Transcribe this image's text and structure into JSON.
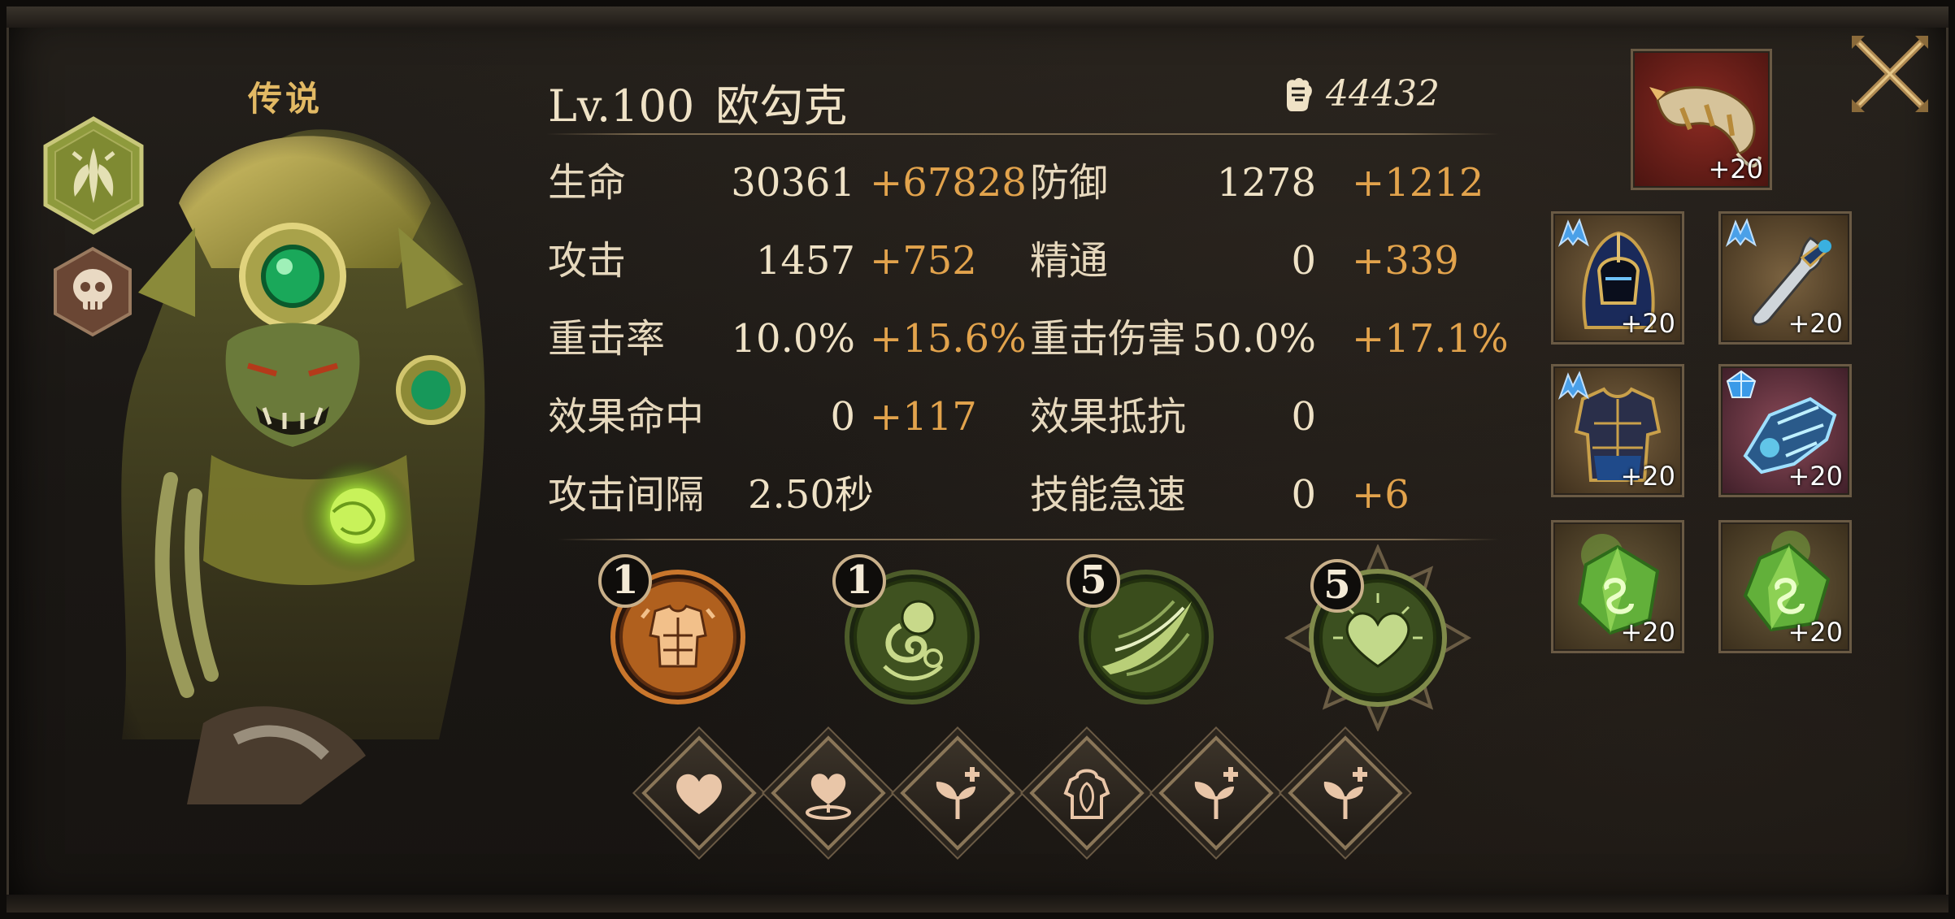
{
  "hero": {
    "rarity": "传说",
    "level": "Lv.100",
    "name": "欧勾克",
    "power": "44432"
  },
  "stats": [
    {
      "label": "生命",
      "base": "30361",
      "bonus": "+67828"
    },
    {
      "label": "防御",
      "base": "1278",
      "bonus": "+1212"
    },
    {
      "label": "攻击",
      "base": "1457",
      "bonus": "+752"
    },
    {
      "label": "精通",
      "base": "0",
      "bonus": "+339"
    },
    {
      "label": "重击率",
      "base": "10.0%",
      "bonus": "+15.6%"
    },
    {
      "label": "重击伤害",
      "base": "50.0%",
      "bonus": "+17.1%"
    },
    {
      "label": "效果命中",
      "base": "0",
      "bonus": "+117"
    },
    {
      "label": "效果抵抗",
      "base": "0",
      "bonus": ""
    },
    {
      "label": "攻击间隔",
      "base": "2.50秒",
      "bonus": ""
    },
    {
      "label": "技能急速",
      "base": "0",
      "bonus": "+6"
    }
  ],
  "skills": [
    {
      "level": "1",
      "icon": "armor-skill-icon"
    },
    {
      "level": "1",
      "icon": "vine-skill-icon"
    },
    {
      "level": "5",
      "icon": "leaf-strike-skill-icon"
    },
    {
      "level": "5",
      "icon": "heart-skill-icon"
    }
  ],
  "traits": [
    {
      "icon": "heart-icon"
    },
    {
      "icon": "heart-aura-icon"
    },
    {
      "icon": "sprout-plus-icon"
    },
    {
      "icon": "body-shield-icon"
    },
    {
      "icon": "sprout-plus-icon"
    },
    {
      "icon": "sprout-plus-icon"
    }
  ],
  "equipment": [
    {
      "slot": "horn-relic",
      "level": "+20"
    },
    {
      "slot": "helmet",
      "level": "+20"
    },
    {
      "slot": "dagger",
      "level": "+20"
    },
    {
      "slot": "armor",
      "level": "+20"
    },
    {
      "slot": "gauntlet",
      "level": "+20"
    },
    {
      "slot": "gem-left",
      "level": "+20"
    },
    {
      "slot": "gem-right",
      "level": "+20"
    }
  ],
  "colors": {
    "bonus": "#e2a34c",
    "rarity": "#e2b964",
    "text": "#efe2c6"
  }
}
